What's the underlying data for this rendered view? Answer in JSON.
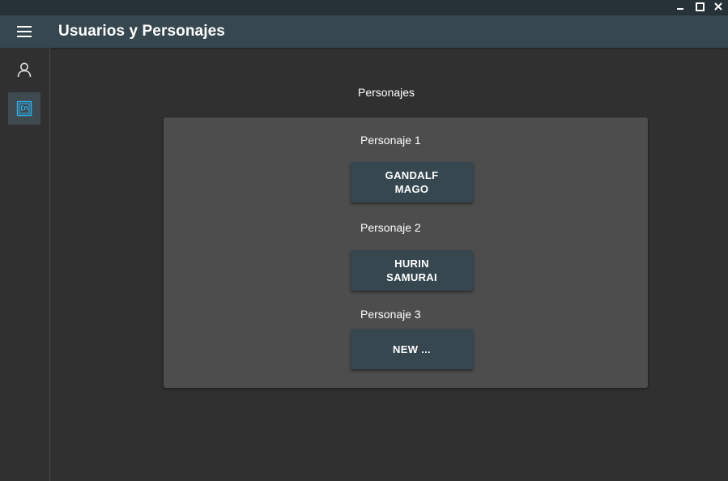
{
  "window": {
    "controls": [
      "minimize-icon",
      "maximize-icon",
      "close-icon"
    ]
  },
  "appbar": {
    "title": "Usuarios y Personajes",
    "menu_icon": "hamburger-menu-icon"
  },
  "sidebar": {
    "items": [
      {
        "icon": "user-icon",
        "active": false
      },
      {
        "icon": "characters-icon",
        "active": true
      }
    ]
  },
  "main": {
    "section_title": "Personajes",
    "characters": [
      {
        "label": "Personaje 1",
        "line1": "GANDALF",
        "line2": "MAGO"
      },
      {
        "label": "Personaje 2",
        "line1": "HURIN",
        "line2": "SAMURAI"
      },
      {
        "label": "Personaje 3",
        "line1": "NEW ...",
        "line2": ""
      }
    ]
  },
  "colors": {
    "background": "#303030",
    "titlebar": "#263238",
    "appbar": "#37474f",
    "card": "#4d4d4d",
    "button": "#37474f",
    "accent": "#29b6f6"
  }
}
